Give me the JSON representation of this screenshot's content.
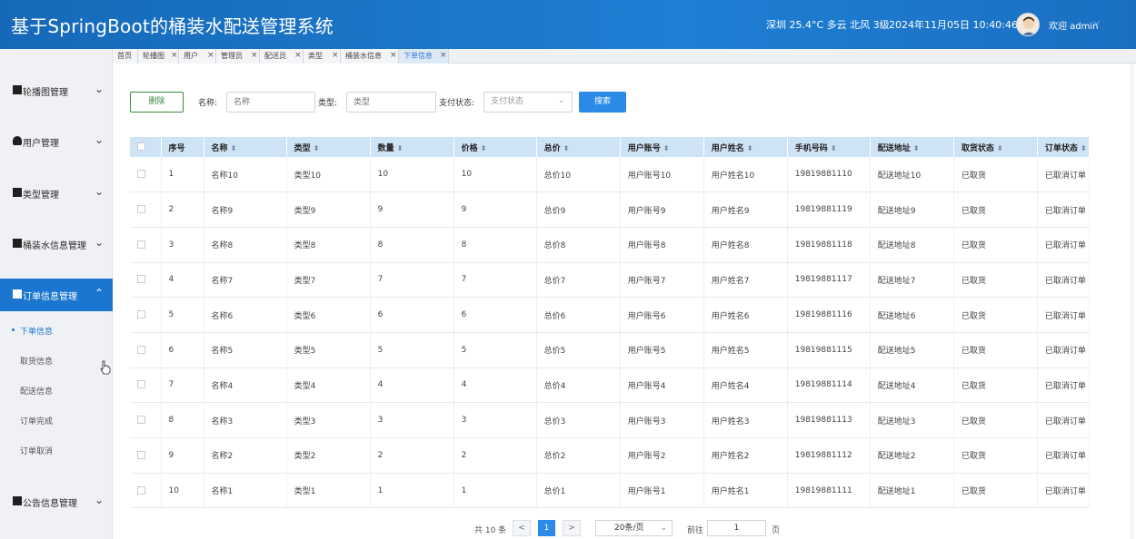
{
  "header": {
    "title": "基于SpringBoot的桶装水配送管理系统",
    "weather": "深圳 25.4°C 多云 北风 3级",
    "datetime": "2024年11月05日 10:40:46",
    "welcome": "欢迎 admin",
    "brand_color": "#1a73c8"
  },
  "tabs": [
    {
      "label": "首页"
    },
    {
      "label": "轮播图"
    },
    {
      "label": "用户"
    },
    {
      "label": "管理员"
    },
    {
      "label": "配送员"
    },
    {
      "label": "类型"
    },
    {
      "label": "桶装水信息"
    },
    {
      "label": "下单信息",
      "active": true
    }
  ],
  "sidebar": {
    "menus": [
      {
        "label": "轮播图管理",
        "icon": "image-icon"
      },
      {
        "label": "用户管理",
        "icon": "user-icon"
      },
      {
        "label": "类型管理",
        "icon": "type-icon"
      },
      {
        "label": "桶装水信息管理",
        "icon": "grid-icon"
      },
      {
        "label": "订单信息管理",
        "icon": "order-icon",
        "open": true
      },
      {
        "label": "公告信息管理",
        "icon": "notice-icon"
      }
    ],
    "submenu": [
      "下单信息",
      "取货信息",
      "配送信息",
      "订单完成",
      "订单取消"
    ]
  },
  "toolbar": {
    "delete_label": "删除",
    "name_label": "名称:",
    "name_placeholder": "名称",
    "type_label": "类型:",
    "type_placeholder": "类型",
    "pay_label": "支付状态:",
    "pay_placeholder": "支付状态",
    "search_label": "搜索"
  },
  "table": {
    "headers": [
      "序号",
      "名称",
      "类型",
      "数量",
      "价格",
      "总价",
      "用户账号",
      "用户姓名",
      "手机号码",
      "配送地址",
      "取货状态",
      "订单状态"
    ],
    "rows": [
      [
        "1",
        "名称10",
        "类型10",
        "10",
        "10",
        "总价10",
        "用户账号10",
        "用户姓名10",
        "19819881110",
        "配送地址10",
        "已取货",
        "已取消订单"
      ],
      [
        "2",
        "名称9",
        "类型9",
        "9",
        "9",
        "总价9",
        "用户账号9",
        "用户姓名9",
        "19819881119",
        "配送地址9",
        "已取货",
        "已取消订单"
      ],
      [
        "3",
        "名称8",
        "类型8",
        "8",
        "8",
        "总价8",
        "用户账号8",
        "用户姓名8",
        "19819881118",
        "配送地址8",
        "已取货",
        "已取消订单"
      ],
      [
        "4",
        "名称7",
        "类型7",
        "7",
        "7",
        "总价7",
        "用户账号7",
        "用户姓名7",
        "19819881117",
        "配送地址7",
        "已取货",
        "已取消订单"
      ],
      [
        "5",
        "名称6",
        "类型6",
        "6",
        "6",
        "总价6",
        "用户账号6",
        "用户姓名6",
        "19819881116",
        "配送地址6",
        "已取货",
        "已取消订单"
      ],
      [
        "6",
        "名称5",
        "类型5",
        "5",
        "5",
        "总价5",
        "用户账号5",
        "用户姓名5",
        "19819881115",
        "配送地址5",
        "已取货",
        "已取消订单"
      ],
      [
        "7",
        "名称4",
        "类型4",
        "4",
        "4",
        "总价4",
        "用户账号4",
        "用户姓名4",
        "19819881114",
        "配送地址4",
        "已取货",
        "已取消订单"
      ],
      [
        "8",
        "名称3",
        "类型3",
        "3",
        "3",
        "总价3",
        "用户账号3",
        "用户姓名3",
        "19819881113",
        "配送地址3",
        "已取货",
        "已取消订单"
      ],
      [
        "9",
        "名称2",
        "类型2",
        "2",
        "2",
        "总价2",
        "用户账号2",
        "用户姓名2",
        "19819881112",
        "配送地址2",
        "已取货",
        "已取消订单"
      ],
      [
        "10",
        "名称1",
        "类型1",
        "1",
        "1",
        "总价1",
        "用户账号1",
        "用户姓名1",
        "19819881111",
        "配送地址1",
        "已取货",
        "已取消订单"
      ]
    ]
  },
  "pagination": {
    "total": "共 10 条",
    "prev": "<",
    "current": "1",
    "next": ">",
    "page_size": "20条/页",
    "goto_label": "前往",
    "goto_value": "1",
    "page_unit": "页"
  }
}
